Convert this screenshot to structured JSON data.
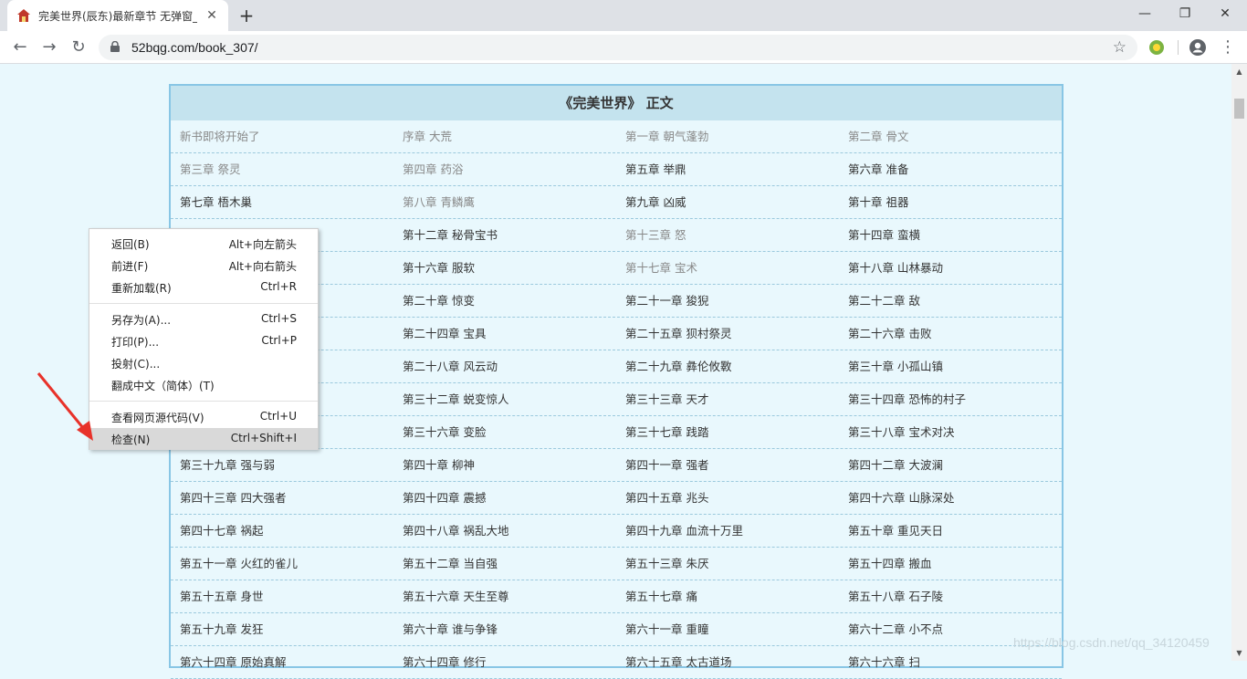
{
  "browser": {
    "tab_title": "完美世界(辰东)最新章节 无弹窗_",
    "tab_close": "✕",
    "new_tab": "+",
    "url": "52bqg.com/book_307/",
    "window_controls": {
      "minimize": "—",
      "restore": "❐",
      "close": "✕"
    },
    "nav": {
      "back": "←",
      "forward": "→",
      "reload": "↻"
    },
    "icons": [
      "favicon-icon",
      "lock-icon",
      "star-icon",
      "extension-icon",
      "profile-icon",
      "menu-icon"
    ]
  },
  "page": {
    "title": "《完美世界》 正文",
    "rows": [
      [
        {
          "t": "新书即将开始了",
          "v": true
        },
        {
          "t": "序章 大荒",
          "v": true
        },
        {
          "t": "第一章 朝气蓬勃",
          "v": true
        },
        {
          "t": "第二章 骨文",
          "v": true
        }
      ],
      [
        {
          "t": "第三章 祭灵",
          "v": true
        },
        {
          "t": "第四章 药浴",
          "v": true
        },
        {
          "t": "第五章 举鼎",
          "v": false
        },
        {
          "t": "第六章 准备",
          "v": false
        }
      ],
      [
        {
          "t": "第七章 梧木巢",
          "v": false
        },
        {
          "t": "第八章 青鳞鹰",
          "v": true
        },
        {
          "t": "第九章 凶威",
          "v": false
        },
        {
          "t": "第十章 祖器",
          "v": false
        }
      ],
      [
        {
          "t": "",
          "v": false
        },
        {
          "t": "第十二章 秘骨宝书",
          "v": false
        },
        {
          "t": "第十三章 怒",
          "v": true
        },
        {
          "t": "第十四章 蛮横",
          "v": false
        }
      ],
      [
        {
          "t": "",
          "v": false
        },
        {
          "t": "第十六章 服软",
          "v": false
        },
        {
          "t": "第十七章 宝术",
          "v": true
        },
        {
          "t": "第十八章 山林暴动",
          "v": false
        }
      ],
      [
        {
          "t": "",
          "v": false
        },
        {
          "t": "第二十章 惊变",
          "v": false
        },
        {
          "t": "第二十一章 狻猊",
          "v": false
        },
        {
          "t": "第二十二章 敌",
          "v": false
        }
      ],
      [
        {
          "t": "",
          "v": false
        },
        {
          "t": "第二十四章 宝具",
          "v": false
        },
        {
          "t": "第二十五章 狈村祭灵",
          "v": false
        },
        {
          "t": "第二十六章 击败",
          "v": false
        }
      ],
      [
        {
          "t": "",
          "v": false
        },
        {
          "t": "第二十八章 风云动",
          "v": false
        },
        {
          "t": "第二十九章 彝伦攸斁",
          "v": false
        },
        {
          "t": "第三十章 小孤山镇",
          "v": false
        }
      ],
      [
        {
          "t": "",
          "v": false
        },
        {
          "t": "第三十二章 蜕变惊人",
          "v": false
        },
        {
          "t": "第三十三章 天才",
          "v": false
        },
        {
          "t": "第三十四章 恐怖的村子",
          "v": false
        }
      ],
      [
        {
          "t": "",
          "v": false
        },
        {
          "t": "第三十六章 变脸",
          "v": false
        },
        {
          "t": "第三十七章 践踏",
          "v": false
        },
        {
          "t": "第三十八章 宝术对决",
          "v": false
        }
      ],
      [
        {
          "t": "第三十九章 强与弱",
          "v": false
        },
        {
          "t": "第四十章 柳神",
          "v": false
        },
        {
          "t": "第四十一章 强者",
          "v": false
        },
        {
          "t": "第四十二章 大波澜",
          "v": false
        }
      ],
      [
        {
          "t": "第四十三章 四大强者",
          "v": false
        },
        {
          "t": "第四十四章 震撼",
          "v": false
        },
        {
          "t": "第四十五章 兆头",
          "v": false
        },
        {
          "t": "第四十六章 山脉深处",
          "v": false
        }
      ],
      [
        {
          "t": "第四十七章 祸起",
          "v": false
        },
        {
          "t": "第四十八章 祸乱大地",
          "v": false
        },
        {
          "t": "第四十九章 血流十万里",
          "v": false
        },
        {
          "t": "第五十章 重见天日",
          "v": false
        }
      ],
      [
        {
          "t": "第五十一章 火红的雀儿",
          "v": false
        },
        {
          "t": "第五十二章 当自强",
          "v": false
        },
        {
          "t": "第五十三章 朱厌",
          "v": false
        },
        {
          "t": "第五十四章 搬血",
          "v": false
        }
      ],
      [
        {
          "t": "第五十五章 身世",
          "v": false
        },
        {
          "t": "第五十六章 天生至尊",
          "v": false
        },
        {
          "t": "第五十七章 痛",
          "v": false
        },
        {
          "t": "第五十八章 石子陵",
          "v": false
        }
      ],
      [
        {
          "t": "第五十九章 发狂",
          "v": false
        },
        {
          "t": "第六十章 谁与争锋",
          "v": false
        },
        {
          "t": "第六十一章 重瞳",
          "v": false
        },
        {
          "t": "第六十二章 小不点",
          "v": false
        }
      ],
      [
        {
          "t": "第六十四章 原始真解",
          "v": false
        },
        {
          "t": "第六十四章 修行",
          "v": false
        },
        {
          "t": "第六十五章 太古道场",
          "v": false
        },
        {
          "t": "第六十六章 扫",
          "v": false
        }
      ]
    ]
  },
  "context_menu": {
    "groups": [
      [
        {
          "label": "返回(B)",
          "key": "Alt+向左箭头"
        },
        {
          "label": "前进(F)",
          "key": "Alt+向右箭头"
        },
        {
          "label": "重新加载(R)",
          "key": "Ctrl+R"
        }
      ],
      [
        {
          "label": "另存为(A)...",
          "key": "Ctrl+S"
        },
        {
          "label": "打印(P)...",
          "key": "Ctrl+P"
        },
        {
          "label": "投射(C)...",
          "key": ""
        },
        {
          "label": "翻成中文（简体）(T)",
          "key": ""
        }
      ],
      [
        {
          "label": "查看网页源代码(V)",
          "key": "Ctrl+U"
        },
        {
          "label": "检查(N)",
          "key": "Ctrl+Shift+I"
        }
      ]
    ],
    "highlighted": "检查(N)"
  },
  "watermark": "https://blog.csdn.net/qq_34120459",
  "colors": {
    "page_bg": "#e9f8fd",
    "box_border": "#88c6e5",
    "title_bg": "#c4e3ee",
    "visited": "#888888",
    "annotation_arrow": "#e8322a"
  }
}
